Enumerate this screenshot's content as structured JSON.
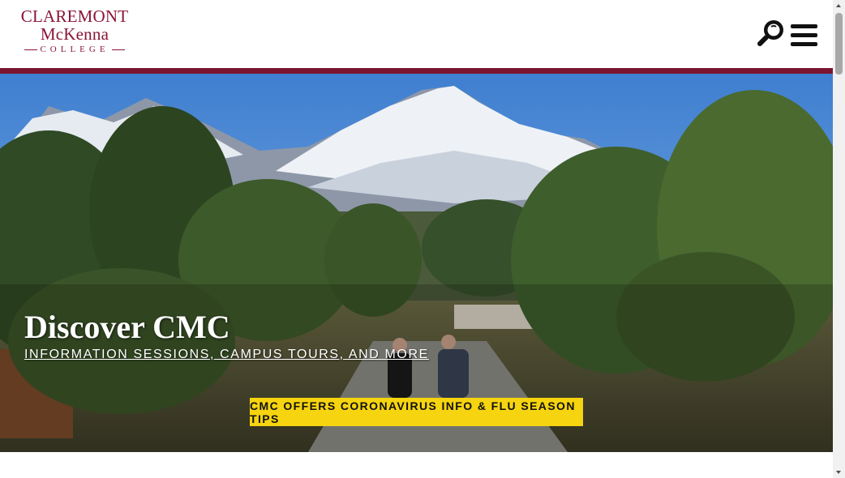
{
  "header": {
    "logo": {
      "line1": "Claremont",
      "line2": "McKenna",
      "line3": "College"
    },
    "search_icon": "search-icon",
    "menu_icon": "hamburger-menu-icon"
  },
  "hero": {
    "title": "Discover CMC",
    "link_label": "INFORMATION SESSIONS, CAMPUS TOURS, AND MORE",
    "alert_label": "CMC OFFERS CORONAVIRUS INFO & FLU SEASON TIPS"
  },
  "colors": {
    "brand_maroon": "#8a1538",
    "alert_yellow": "#f6d40f"
  }
}
